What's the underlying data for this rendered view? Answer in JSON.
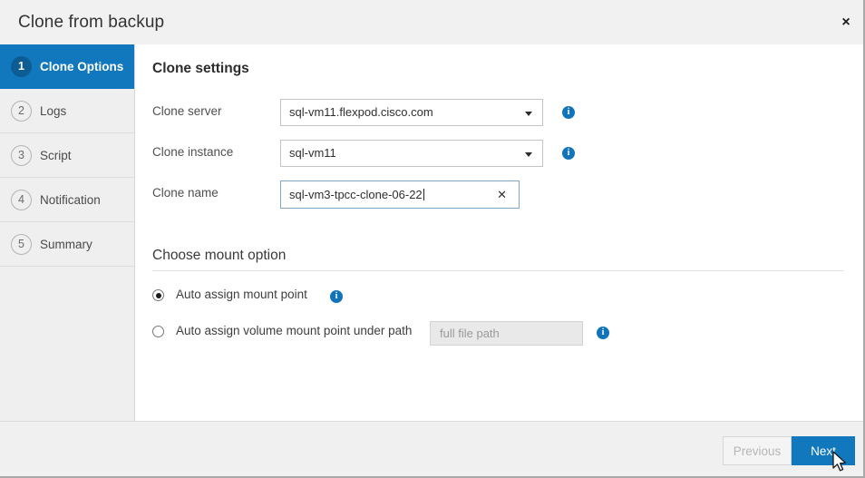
{
  "window": {
    "title": "Clone from backup",
    "close_icon": "close-icon",
    "close_glyph": "×"
  },
  "sidebar": {
    "steps": [
      {
        "number": "1",
        "label": "Clone Options",
        "active": true
      },
      {
        "number": "2",
        "label": "Logs",
        "active": false
      },
      {
        "number": "3",
        "label": "Script",
        "active": false
      },
      {
        "number": "4",
        "label": "Notification",
        "active": false
      },
      {
        "number": "5",
        "label": "Summary",
        "active": false
      }
    ]
  },
  "main": {
    "clone_settings_title": "Clone settings",
    "fields": {
      "clone_server": {
        "label": "Clone server",
        "value": "sql-vm11.flexpod.cisco.com",
        "info_icon": "info-icon"
      },
      "clone_instance": {
        "label": "Clone instance",
        "value": "sql-vm11",
        "info_icon": "info-icon"
      },
      "clone_name": {
        "label": "Clone name",
        "value": "sql-vm3-tpcc-clone-06-22",
        "placeholder": "Clone name",
        "clear_icon": "close-icon",
        "clear_glyph": "✕"
      }
    },
    "mount_option_title": "Choose mount option",
    "mount_options": [
      {
        "label": "Auto assign mount point",
        "selected": true,
        "info_icon": "info-icon"
      },
      {
        "label": "Auto assign volume mount point under path",
        "selected": false,
        "path_placeholder": "full file path",
        "path_value": "",
        "info_icon": "info-icon"
      }
    ]
  },
  "footer": {
    "previous_label": "Previous",
    "previous_enabled": false,
    "next_label": "Next",
    "next_enabled": true
  },
  "colors": {
    "accent_blue": "#1278be",
    "badge_dark_blue": "#0d5c93",
    "info_blue": "#1173ba",
    "sidebar_bg": "#efefef",
    "titlebar_bg": "#f1f1f1",
    "footer_bg": "#f0f0f0",
    "focus_border": "#7fa8c4",
    "disabled_text": "#b6b6b6"
  },
  "glyphs": {
    "info": "i",
    "caret_down": "caret-down-icon"
  }
}
